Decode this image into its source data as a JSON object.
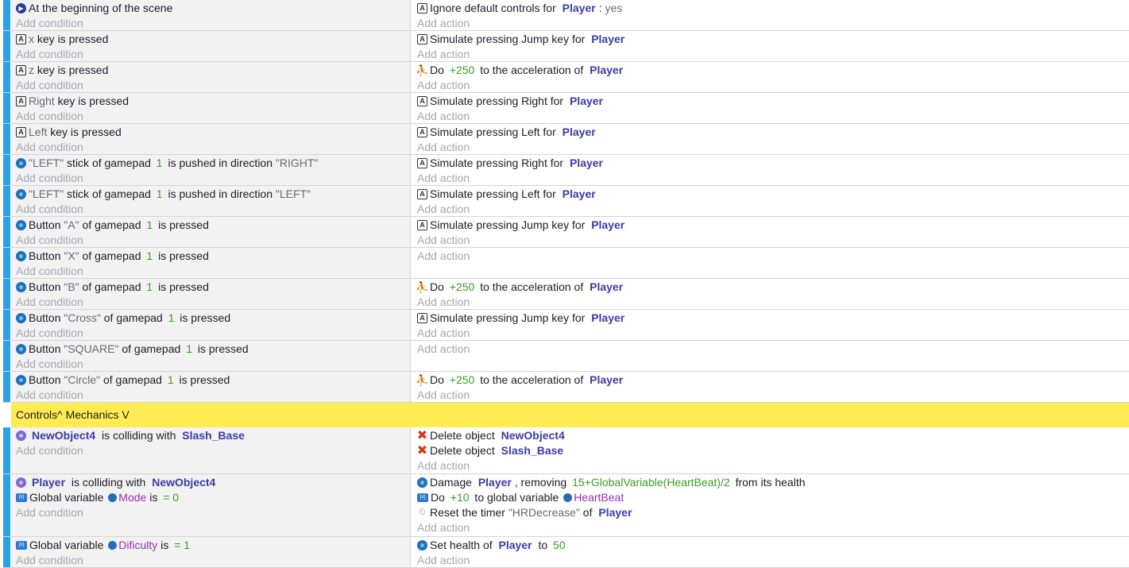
{
  "placeholders": {
    "add_condition": "Add condition",
    "add_action": "Add action"
  },
  "comment": "Controls^ Mechanics V",
  "events": [
    {
      "conditions": [
        {
          "icon": "scene-icon",
          "parts": [
            "At the beginning of the scene"
          ]
        }
      ],
      "actions": [
        {
          "icon": "keyboard-icon",
          "parts": [
            "Ignore default controls for ",
            {
              "obj": "Player"
            },
            {
              "txt": ": "
            },
            {
              "str": "yes"
            }
          ]
        }
      ]
    },
    {
      "conditions": [
        {
          "icon": "keyboard-icon",
          "parts": [
            {
              "str": "x"
            },
            " key is pressed"
          ]
        }
      ],
      "actions": [
        {
          "icon": "keyboard-icon",
          "parts": [
            "Simulate pressing Jump key for ",
            {
              "obj": "Player"
            }
          ]
        }
      ]
    },
    {
      "conditions": [
        {
          "icon": "keyboard-icon",
          "parts": [
            {
              "str": "z"
            },
            " key is pressed"
          ]
        }
      ],
      "actions": [
        {
          "icon": "platformer-icon",
          "parts": [
            "Do ",
            {
              "num": "+250"
            },
            " to the acceleration of ",
            {
              "obj": "Player"
            }
          ]
        }
      ]
    },
    {
      "conditions": [
        {
          "icon": "keyboard-icon",
          "parts": [
            {
              "str": "Right"
            },
            " key is pressed"
          ]
        }
      ],
      "actions": [
        {
          "icon": "keyboard-icon",
          "parts": [
            "Simulate pressing Right for ",
            {
              "obj": "Player"
            }
          ]
        }
      ]
    },
    {
      "conditions": [
        {
          "icon": "keyboard-icon",
          "parts": [
            {
              "str": "Left"
            },
            " key is pressed"
          ]
        }
      ],
      "actions": [
        {
          "icon": "keyboard-icon",
          "parts": [
            "Simulate pressing Left for ",
            {
              "obj": "Player"
            }
          ]
        }
      ]
    },
    {
      "conditions": [
        {
          "icon": "gamepad-icon",
          "parts": [
            {
              "str": "\"LEFT\""
            },
            " stick of gamepad ",
            {
              "num": "1"
            },
            " is pushed in direction ",
            {
              "str": "\"RIGHT\""
            }
          ]
        }
      ],
      "actions": [
        {
          "icon": "keyboard-icon",
          "parts": [
            "Simulate pressing Right for ",
            {
              "obj": "Player"
            }
          ]
        }
      ]
    },
    {
      "conditions": [
        {
          "icon": "gamepad-icon",
          "parts": [
            {
              "str": "\"LEFT\""
            },
            " stick of gamepad ",
            {
              "num": "1"
            },
            " is pushed in direction ",
            {
              "str": "\"LEFT\""
            }
          ]
        }
      ],
      "actions": [
        {
          "icon": "keyboard-icon",
          "parts": [
            "Simulate pressing Left for ",
            {
              "obj": "Player"
            }
          ]
        }
      ]
    },
    {
      "conditions": [
        {
          "icon": "gamepad-icon",
          "parts": [
            "Button ",
            {
              "str": "\"A\""
            },
            " of gamepad ",
            {
              "num": "1"
            },
            " is pressed"
          ]
        }
      ],
      "actions": [
        {
          "icon": "keyboard-icon",
          "parts": [
            "Simulate pressing Jump key for ",
            {
              "obj": "Player"
            }
          ]
        }
      ]
    },
    {
      "conditions": [
        {
          "icon": "gamepad-icon",
          "parts": [
            "Button ",
            {
              "str": "\"X\""
            },
            " of gamepad ",
            {
              "num": "1"
            },
            " is pressed"
          ]
        }
      ],
      "actions": []
    },
    {
      "conditions": [
        {
          "icon": "gamepad-icon",
          "parts": [
            "Button ",
            {
              "str": "\"B\""
            },
            " of gamepad ",
            {
              "num": "1"
            },
            " is pressed"
          ]
        }
      ],
      "actions": [
        {
          "icon": "platformer-icon",
          "parts": [
            "Do ",
            {
              "num": "+250"
            },
            " to the acceleration of ",
            {
              "obj": "Player"
            }
          ]
        }
      ]
    },
    {
      "conditions": [
        {
          "icon": "gamepad-icon",
          "parts": [
            "Button ",
            {
              "str": "\"Cross\""
            },
            " of gamepad ",
            {
              "num": "1"
            },
            " is pressed"
          ]
        }
      ],
      "actions": [
        {
          "icon": "keyboard-icon",
          "parts": [
            "Simulate pressing Jump key for ",
            {
              "obj": "Player"
            }
          ]
        }
      ]
    },
    {
      "conditions": [
        {
          "icon": "gamepad-icon",
          "parts": [
            "Button ",
            {
              "str": "\"SQUARE\""
            },
            " of gamepad ",
            {
              "num": "1"
            },
            " is pressed"
          ]
        }
      ],
      "actions": []
    },
    {
      "conditions": [
        {
          "icon": "gamepad-icon",
          "parts": [
            "Button ",
            {
              "str": "\"Circle\""
            },
            " of gamepad ",
            {
              "num": "1"
            },
            " is pressed"
          ]
        }
      ],
      "actions": [
        {
          "icon": "platformer-icon",
          "parts": [
            "Do ",
            {
              "num": "+250"
            },
            " to the acceleration of ",
            {
              "obj": "Player"
            }
          ]
        }
      ]
    },
    {
      "conditions": [
        {
          "icon": "collision-icon",
          "parts": [
            {
              "obj": "NewObject4"
            },
            " is colliding with ",
            {
              "obj": "Slash_Base"
            }
          ]
        }
      ],
      "actions": [
        {
          "icon": "delete-icon",
          "parts": [
            "Delete object ",
            {
              "obj": "NewObject4"
            }
          ]
        },
        {
          "icon": "delete-icon",
          "parts": [
            "Delete object ",
            {
              "obj": "Slash_Base"
            }
          ]
        }
      ]
    },
    {
      "conditions": [
        {
          "icon": "collision-icon",
          "parts": [
            {
              "obj": "Player"
            },
            " is colliding with ",
            {
              "obj": "NewObject4"
            }
          ]
        },
        {
          "icon": "variable-icon",
          "parts": [
            "Global variable ",
            {
              "var": "Mode"
            },
            " is ",
            {
              "num": "= 0"
            }
          ]
        }
      ],
      "actions": [
        {
          "icon": "health-icon",
          "parts": [
            "Damage ",
            {
              "obj": "Player"
            },
            ", removing ",
            {
              "num": "15+GlobalVariable(HeartBeat)/2"
            },
            " from its health"
          ]
        },
        {
          "icon": "variable-icon",
          "parts": [
            "Do ",
            {
              "num": "+10"
            },
            " to global variable ",
            {
              "var": "HeartBeat"
            }
          ]
        },
        {
          "icon": "timer-icon",
          "parts": [
            "Reset the timer ",
            {
              "str": "\"HRDecrease\""
            },
            " of ",
            {
              "obj": "Player"
            }
          ]
        }
      ]
    },
    {
      "conditions": [
        {
          "icon": "variable-icon",
          "parts": [
            "Global variable ",
            {
              "var": "Dificulty"
            },
            " is ",
            {
              "num": "= 1"
            }
          ]
        }
      ],
      "actions": [
        {
          "icon": "health-icon",
          "parts": [
            "Set health of ",
            {
              "obj": "Player"
            },
            " to ",
            {
              "num": "50"
            }
          ]
        }
      ]
    }
  ]
}
